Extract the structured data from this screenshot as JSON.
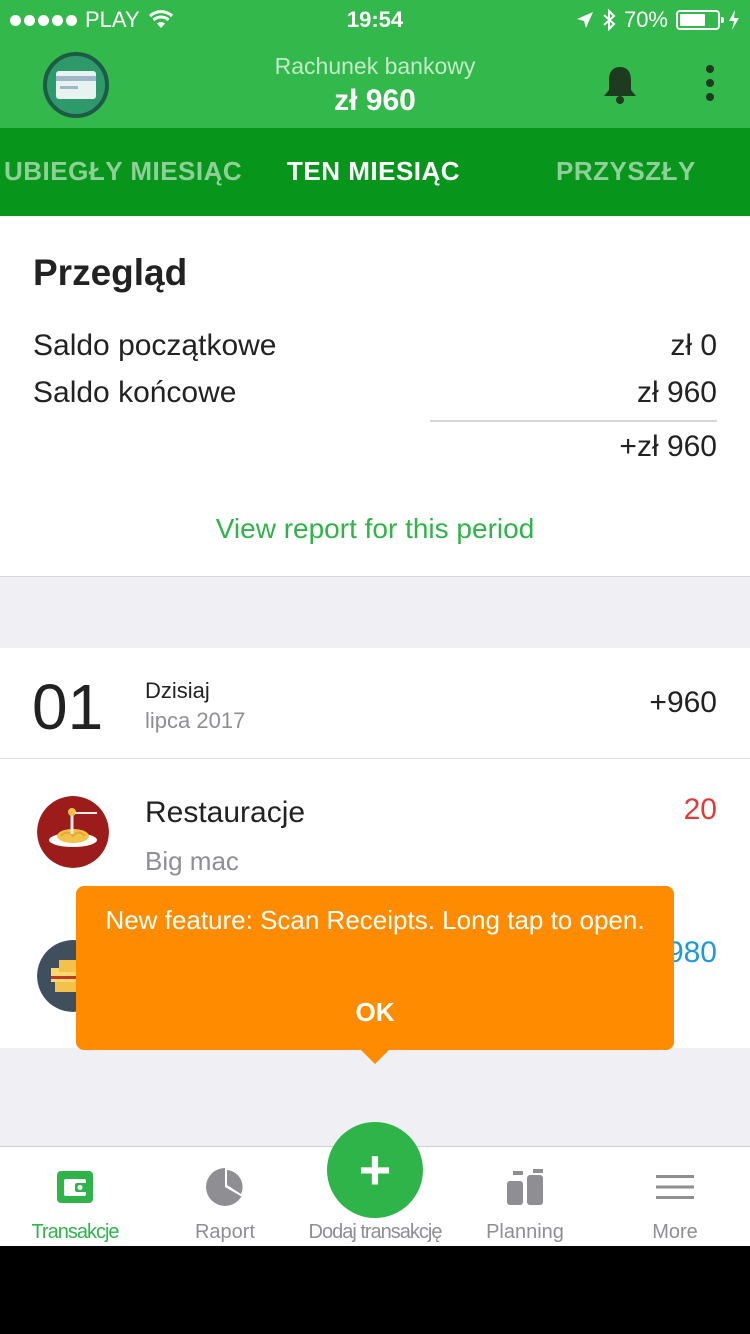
{
  "status_bar": {
    "carrier": "PLAY",
    "time": "19:54",
    "battery": "70%",
    "battery_level": 0.7
  },
  "header": {
    "account_name": "Rachunek bankowy",
    "account_balance": "zł 960",
    "avatar_icon": "credit-card-icon",
    "notification_icon": "bell-icon",
    "menu_icon": "more-vertical-icon"
  },
  "tabs": {
    "previous": "UBIEGŁY MIESIĄC",
    "current": "TEN MIESIĄC",
    "next": "PRZYSZŁY"
  },
  "overview": {
    "title": "Przegląd",
    "opening_label": "Saldo początkowe",
    "opening_value": "zł 0",
    "closing_label": "Saldo końcowe",
    "closing_value": "zł 960",
    "difference": "+zł 960",
    "report_link": "View report for this period"
  },
  "transactions": {
    "day": {
      "number": "01",
      "name": "Dzisiaj",
      "month": "lipca 2017",
      "total": "+960"
    },
    "items": [
      {
        "title": "Restauracje",
        "note": "Big mac",
        "amount": "20",
        "icon": "restaurant-icon",
        "amount_color": "#e53935"
      },
      {
        "title": "",
        "note": "",
        "amount": "980",
        "icon": "salary-icon",
        "amount_color": "#1e9ad6"
      }
    ]
  },
  "tooltip": {
    "message": "New feature: Scan Receipts. Long tap to open.",
    "ok_label": "OK"
  },
  "bottom_nav": {
    "transactions": "Transakcje",
    "report": "Raport",
    "add": "Dodaj transakcję",
    "planning": "Planning",
    "more": "More"
  },
  "colors": {
    "brand_green": "#33b84b",
    "tab_green": "#07961b",
    "tooltip_orange": "#ff8c00",
    "link_green": "#2fb44a"
  }
}
